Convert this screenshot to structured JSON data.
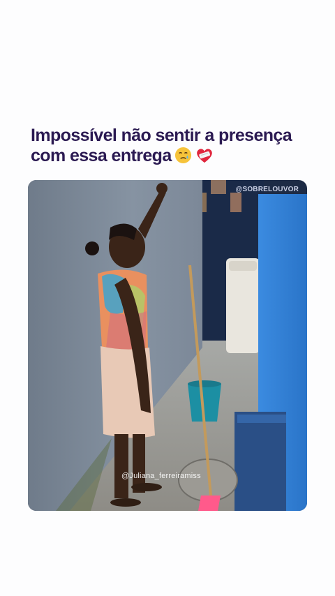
{
  "caption": {
    "line1": "Impossível não sentir a presença",
    "line2": "com essa entrega"
  },
  "caption_emojis": [
    "smiling-face-with-tear-icon",
    "mending-heart-icon"
  ],
  "photo": {
    "watermark": "@SOBRELOUVOR",
    "credit": "@Juliana_ferreiramiss"
  },
  "colors": {
    "caption": "#2b1a52",
    "background": "#fdfdfe",
    "wall": "#7b8796",
    "blue_wall": "#2e7fd8"
  }
}
